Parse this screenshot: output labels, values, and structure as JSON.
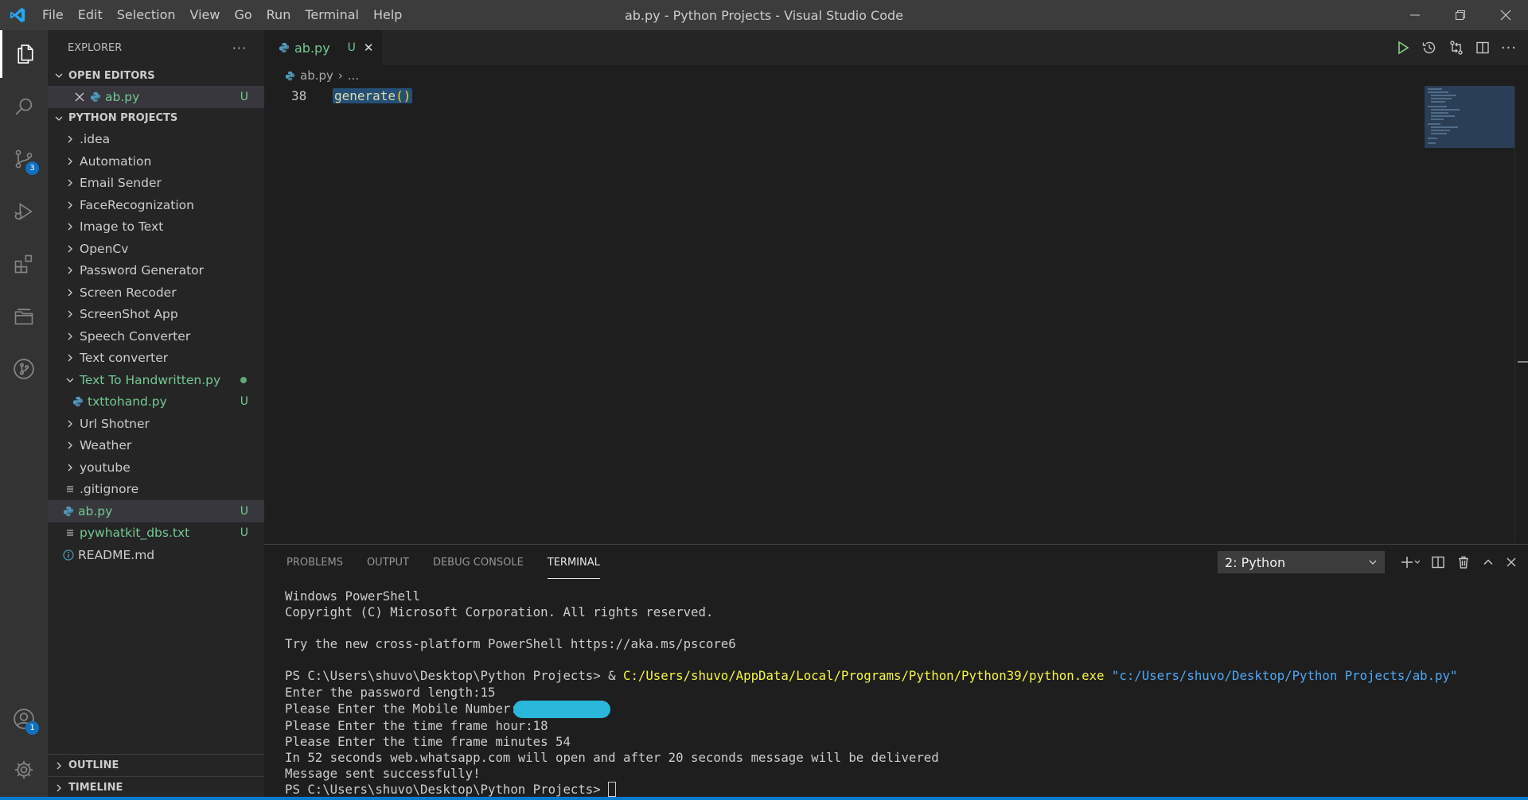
{
  "window": {
    "title": "ab.py - Python Projects - Visual Studio Code",
    "menu": [
      "File",
      "Edit",
      "Selection",
      "View",
      "Go",
      "Run",
      "Terminal",
      "Help"
    ]
  },
  "activity_bar": {
    "items": [
      {
        "icon": "files-icon",
        "active": true
      },
      {
        "icon": "search-icon"
      },
      {
        "icon": "source-control-icon",
        "badge": "3"
      },
      {
        "icon": "run-debug-icon"
      },
      {
        "icon": "extensions-icon"
      },
      {
        "icon": "remote-explorer-icon"
      },
      {
        "icon": "git-graph-icon"
      }
    ],
    "account_badge": "1"
  },
  "sidebar": {
    "header": "EXPLORER",
    "more": "···",
    "open_editors": {
      "title": "OPEN EDITORS",
      "items": [
        {
          "label": "ab.py",
          "status": "U"
        }
      ]
    },
    "project": {
      "title": "PYTHON PROJECTS",
      "items": [
        {
          "label": ".idea",
          "type": "folder"
        },
        {
          "label": "Automation",
          "type": "folder"
        },
        {
          "label": "Email Sender",
          "type": "folder"
        },
        {
          "label": "FaceRecognization",
          "type": "folder"
        },
        {
          "label": "Image to Text",
          "type": "folder"
        },
        {
          "label": "OpenCv",
          "type": "folder"
        },
        {
          "label": "Password Generator",
          "type": "folder"
        },
        {
          "label": "Screen Recoder",
          "type": "folder"
        },
        {
          "label": "ScreenShot App",
          "type": "folder"
        },
        {
          "label": "Speech Converter",
          "type": "folder"
        },
        {
          "label": "Text converter",
          "type": "folder"
        },
        {
          "label": "Text To Handwritten.py",
          "type": "folder-open"
        },
        {
          "label": "txttohand.py",
          "type": "py-child",
          "status": "U"
        },
        {
          "label": "Url Shotner",
          "type": "folder"
        },
        {
          "label": "Weather",
          "type": "folder"
        },
        {
          "label": "youtube",
          "type": "folder"
        },
        {
          "label": ".gitignore",
          "type": "file"
        },
        {
          "label": "ab.py",
          "type": "py",
          "status": "U"
        },
        {
          "label": "pywhatkit_dbs.txt",
          "type": "file",
          "status": "U"
        },
        {
          "label": "README.md",
          "type": "info"
        }
      ]
    },
    "outline": "OUTLINE",
    "timeline": "TIMELINE"
  },
  "editor": {
    "tab": {
      "label": "ab.py",
      "status": "U",
      "close": "✕"
    },
    "breadcrumb": {
      "file": "ab.py",
      "sep": "›",
      "rest": "..."
    },
    "line_number": "38",
    "code": {
      "fn": "generate",
      "parens": "()"
    }
  },
  "panel": {
    "tabs": [
      "PROBLEMS",
      "OUTPUT",
      "DEBUG CONSOLE",
      "TERMINAL"
    ],
    "active_tab": "TERMINAL",
    "terminal_select": "2: Python",
    "terminal": {
      "l1": "Windows PowerShell",
      "l2": "Copyright (C) Microsoft Corporation. All rights reserved.",
      "l3": "Try the new cross-platform PowerShell https://aka.ms/pscore6",
      "prompt": "PS C:\\Users\\shuvo\\Desktop\\Python Projects> ",
      "amp": "& ",
      "exe": "C:/Users/shuvo/AppData/Local/Programs/Python/Python39/python.exe",
      "arg": " \"c:/Users/shuvo/Desktop/Python Projects/ab.py\"",
      "l5": "Enter the password length:15",
      "l6": "Please Enter the Mobile Number:",
      "l7": "Please Enter the time frame hour:18",
      "l8": "Please Enter the time frame minutes 54",
      "l9": "In 52 seconds web.whatsapp.com will open and after 20 seconds message will be delivered",
      "l10": "Message sent successfully!",
      "l11": "PS C:\\Users\\shuvo\\Desktop\\Python Projects> "
    }
  },
  "colors": {
    "untracked": "#73c991",
    "accent": "#007acc",
    "selection": "#264f78",
    "terminal_path": "#f5f543",
    "terminal_string": "#4fa7f5"
  }
}
